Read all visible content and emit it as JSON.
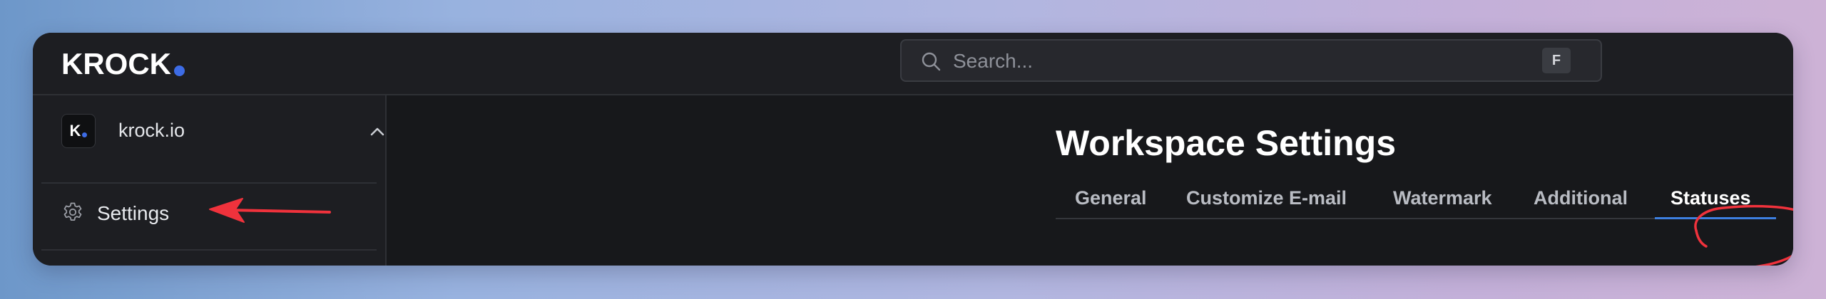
{
  "app": {
    "logo_text": "KROCK",
    "accent_color": "#3d6ce6"
  },
  "search": {
    "placeholder": "Search...",
    "value": "",
    "shortcut_key": "F",
    "icon": "search-icon"
  },
  "sidebar": {
    "workspace": {
      "avatar_letter": "K",
      "name": "krock.io",
      "expanded": true,
      "icon": "chevron-up-icon"
    },
    "items": [
      {
        "label": "Settings",
        "icon": "gear-icon"
      }
    ]
  },
  "main": {
    "title": "Workspace Settings",
    "tabs": [
      {
        "label": "General",
        "active": false
      },
      {
        "label": "Customize E-mail",
        "active": false
      },
      {
        "label": "Watermark",
        "active": false
      },
      {
        "label": "Additional",
        "active": false
      },
      {
        "label": "Statuses",
        "active": true
      }
    ]
  },
  "annotations": {
    "color": "#f0323c",
    "arrow_target": "Settings",
    "circle_target": "Statuses"
  }
}
